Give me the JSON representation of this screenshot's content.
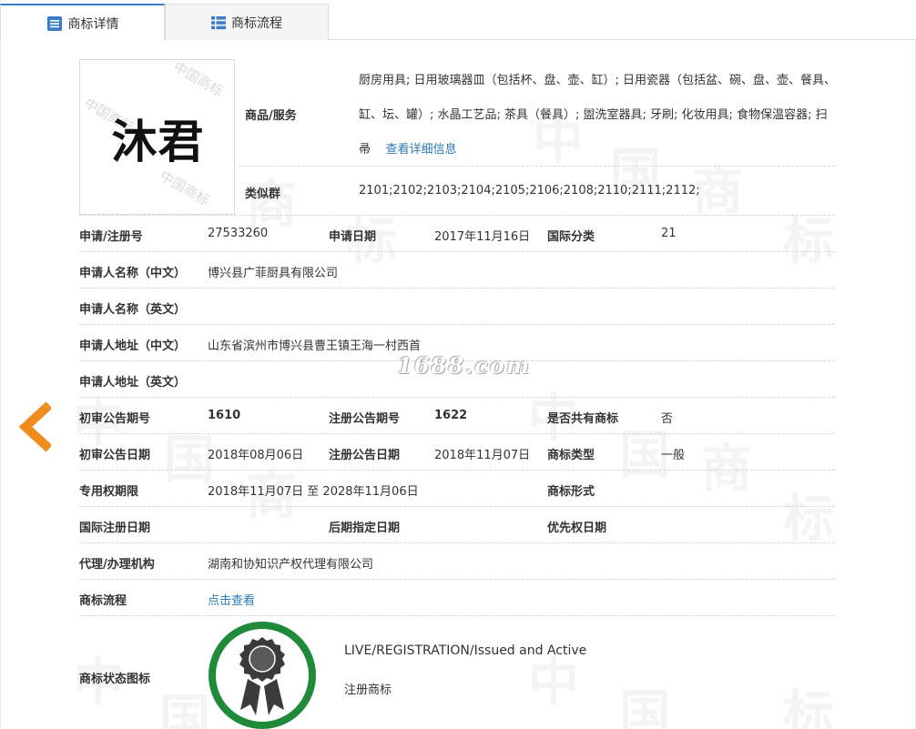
{
  "tabs": [
    {
      "label": "商标详情"
    },
    {
      "label": "商标流程"
    }
  ],
  "logo": {
    "text": "沐君",
    "watermark": "中国商标"
  },
  "goods": {
    "label": "商品/服务",
    "text": "厨房用具; 日用玻璃器皿（包括杯、盘、壶、缸）; 日用瓷器（包括盆、碗、盘、壶、餐具、缸、坛、罐）; 水晶工艺品; 茶具（餐具）; 盥洗室器具; 牙刷; 化妆用具; 食物保温容器; 扫帚",
    "link": "查看详细信息"
  },
  "similar": {
    "label": "类似群",
    "value": "2101;2102;2103;2104;2105;2106;2108;2110;2111;2112;"
  },
  "fields": {
    "reg_no_label": "申请/注册号",
    "reg_no": "27533260",
    "apply_date_label": "申请日期",
    "apply_date": "2017年11月16日",
    "intl_class_label": "国际分类",
    "intl_class": "21",
    "applicant_cn_label": "申请人名称（中文）",
    "applicant_cn": "博兴县广菲厨具有限公司",
    "applicant_en_label": "申请人名称（英文）",
    "applicant_en": "",
    "address_cn_label": "申请人地址（中文）",
    "address_cn": "山东省滨州市博兴县曹王镇王海一村西首",
    "address_en_label": "申请人地址（英文）",
    "address_en": "",
    "prelim_no_label": "初审公告期号",
    "prelim_no": "1610",
    "reg_notice_no_label": "注册公告期号",
    "reg_notice_no": "1622",
    "shared_label": "是否共有商标",
    "shared": "否",
    "prelim_date_label": "初审公告日期",
    "prelim_date": "2018年08月06日",
    "reg_notice_date_label": "注册公告日期",
    "reg_notice_date": "2018年11月07日",
    "type_label": "商标类型",
    "type": "一般",
    "term_label": "专用权期限",
    "term": "2018年11月07日 至 2028年11月06日",
    "form_label": "商标形式",
    "form": "",
    "intl_reg_date_label": "国际注册日期",
    "intl_reg_date": "",
    "later_date_label": "后期指定日期",
    "later_date": "",
    "priority_date_label": "优先权日期",
    "priority_date": "",
    "agent_label": "代理/办理机构",
    "agent": "湖南和协知识产权代理有限公司",
    "flow_label": "商标流程",
    "flow_link": "点击查看",
    "status_label": "商标状态图标"
  },
  "status": {
    "en": "LIVE/REGISTRATION/Issued and Active",
    "cn": "注册商标"
  },
  "site_watermark": "1688.com",
  "bg_watermark_chars": [
    "中",
    "国",
    "商",
    "标"
  ],
  "colors": {
    "accent": "#3a7cc8",
    "link": "#2a7ab8",
    "arrow": "#f08c1e",
    "status_ring": "#1f8b3a"
  }
}
